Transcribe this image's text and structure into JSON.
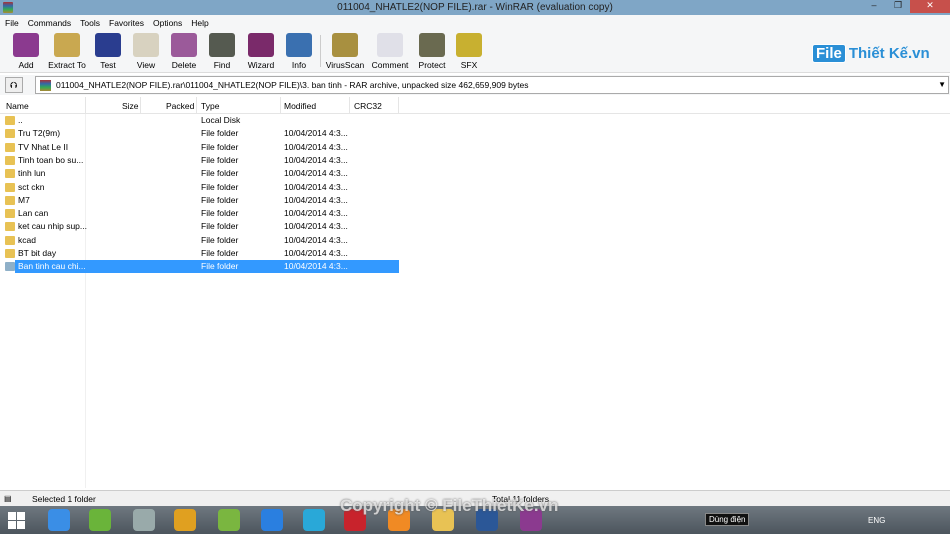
{
  "window": {
    "title": "011004_NHATLE2(NOP FILE).rar - WinRAR (evaluation copy)",
    "minimize": "–",
    "restore": "❐",
    "close": "✕"
  },
  "menu": [
    "File",
    "Commands",
    "Tools",
    "Favorites",
    "Options",
    "Help"
  ],
  "toolbar": [
    {
      "label": "Add",
      "icon": "add-archive-icon",
      "color": "#8b3a8f"
    },
    {
      "label": "Extract To",
      "icon": "extract-icon",
      "color": "#c9a850"
    },
    {
      "label": "Test",
      "icon": "test-icon",
      "color": "#2a3d8f"
    },
    {
      "label": "View",
      "icon": "view-icon",
      "color": "#d8d2c0"
    },
    {
      "label": "Delete",
      "icon": "delete-icon",
      "color": "#9b5a9a"
    },
    {
      "label": "Find",
      "icon": "find-icon",
      "color": "#555a50"
    },
    {
      "label": "Wizard",
      "icon": "wizard-icon",
      "color": "#7a2a6a"
    },
    {
      "label": "Info",
      "icon": "info-icon",
      "color": "#3a70b0"
    },
    {
      "label": "VirusScan",
      "icon": "virusscan-icon",
      "color": "#a89040"
    },
    {
      "label": "Comment",
      "icon": "comment-icon",
      "color": "#e0e0e8"
    },
    {
      "label": "Protect",
      "icon": "protect-icon",
      "color": "#6a6a50"
    },
    {
      "label": "SFX",
      "icon": "sfx-icon",
      "color": "#c8b030"
    }
  ],
  "logo": {
    "part1": "File",
    "part2": "Thiết Kế.vn"
  },
  "address": {
    "path": "011004_NHATLE2(NOP FILE).rar\\011004_NHATLE2(NOP FILE)\\3. ban tinh - RAR archive, unpacked size 462,659,909 bytes",
    "up": "⮉"
  },
  "columns": {
    "name": "Name",
    "size": "Size",
    "packed": "Packed",
    "type": "Type",
    "modified": "Modified",
    "crc": "CRC32"
  },
  "files": [
    {
      "name": "..",
      "type": "Local Disk",
      "modified": ""
    },
    {
      "name": "Tru T2(9m)",
      "type": "File folder",
      "modified": "10/04/2014 4:3..."
    },
    {
      "name": "TV Nhat Le II",
      "type": "File folder",
      "modified": "10/04/2014 4:3..."
    },
    {
      "name": "Tinh toan bo su...",
      "type": "File folder",
      "modified": "10/04/2014 4:3..."
    },
    {
      "name": "tinh lun",
      "type": "File folder",
      "modified": "10/04/2014 4:3..."
    },
    {
      "name": "sct ckn",
      "type": "File folder",
      "modified": "10/04/2014 4:3..."
    },
    {
      "name": "M7",
      "type": "File folder",
      "modified": "10/04/2014 4:3..."
    },
    {
      "name": "Lan can",
      "type": "File folder",
      "modified": "10/04/2014 4:3..."
    },
    {
      "name": "ket cau nhip sup...",
      "type": "File folder",
      "modified": "10/04/2014 4:3..."
    },
    {
      "name": "kcad",
      "type": "File folder",
      "modified": "10/04/2014 4:3..."
    },
    {
      "name": "BT bit day",
      "type": "File folder",
      "modified": "10/04/2014 4:3..."
    },
    {
      "name": "Ban tinh cau chi...",
      "type": "File folder",
      "modified": "10/04/2014 4:3...",
      "selected": true
    }
  ],
  "status": {
    "left": "Selected 1 folder",
    "right": "Total 11 folders"
  },
  "watermark": "Copyright © FileThietKe.vn",
  "taskbar": {
    "apps": [
      {
        "name": "internet-explorer",
        "color": "#3a8ee6"
      },
      {
        "name": "utorrent",
        "color": "#6ab43a"
      },
      {
        "name": "paint",
        "color": "#9aa"
      },
      {
        "name": "chrome",
        "color": "#e0a020"
      },
      {
        "name": "coccoc",
        "color": "#7ab640"
      },
      {
        "name": "zalo",
        "color": "#2a7fe0"
      },
      {
        "name": "app-p",
        "color": "#29a8d8"
      },
      {
        "name": "autocad",
        "color": "#c8232c"
      },
      {
        "name": "foxit-pdf",
        "color": "#f08a24"
      },
      {
        "name": "file-explorer",
        "color": "#e8c254"
      },
      {
        "name": "word",
        "color": "#2b5797"
      },
      {
        "name": "winrar",
        "color": "#8b3a8f"
      }
    ],
    "tooltip": "Dùng điện",
    "language": "ENG"
  }
}
